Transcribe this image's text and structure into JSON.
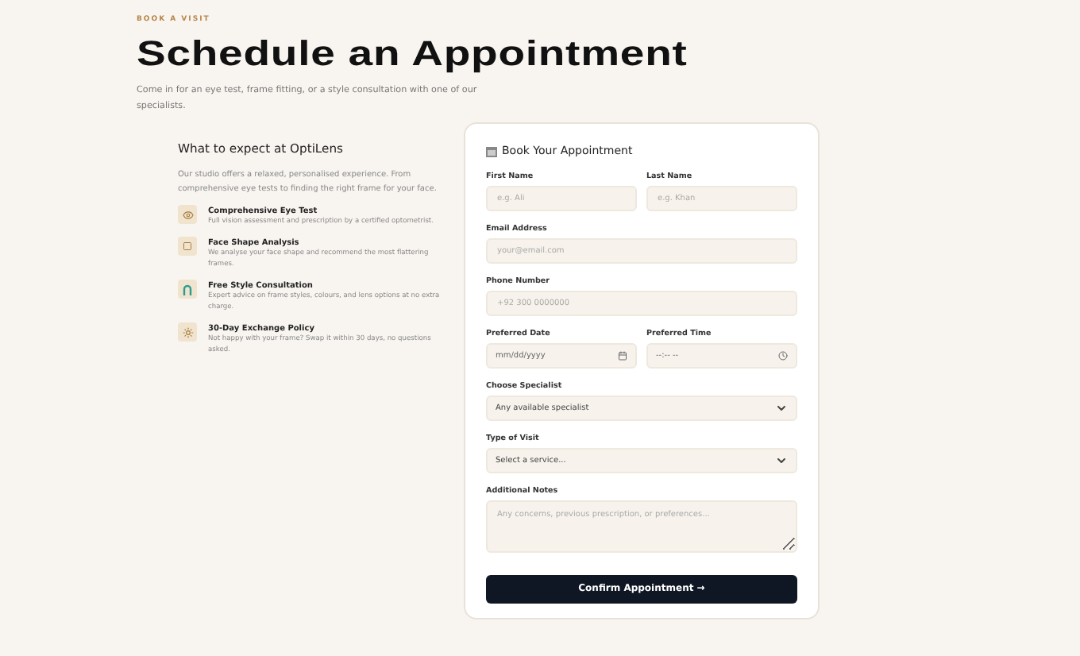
{
  "eyebrow": "BOOK A VISIT",
  "title": "Schedule an Appointment",
  "intro": "Come in for an eye test, frame fitting, or a style consultation with one of our specialists.",
  "info": {
    "heading": "What to expect at OptiLens",
    "text": "Our studio offers a relaxed, personalised experience. From comprehensive eye tests to finding the right frame for your face.",
    "features": [
      {
        "title": "Comprehensive Eye Test",
        "text": "Full vision assessment and prescription by a certified optometrist."
      },
      {
        "title": "Face Shape Analysis",
        "text": "We analyse your face shape and recommend the most flattering frames."
      },
      {
        "title": "Free Style Consultation",
        "text": "Expert advice on frame styles, colours, and lens options at no extra charge."
      },
      {
        "title": "30-Day Exchange Policy",
        "text": "Not happy with your frame? Swap it within 30 days, no questions asked."
      }
    ]
  },
  "form": {
    "heading": "Book Your Appointment",
    "rows": [
      [
        {
          "kind": "text",
          "label": "First Name",
          "placeholder": "e.g. Ali"
        },
        {
          "kind": "text",
          "label": "Last Name",
          "placeholder": "e.g. Khan"
        }
      ],
      [
        {
          "kind": "text",
          "label": "Email Address",
          "placeholder": "your@email.com"
        }
      ],
      [
        {
          "kind": "text",
          "label": "Phone Number",
          "placeholder": "+92 300 0000000"
        }
      ],
      [
        {
          "kind": "date",
          "label": "Preferred Date",
          "value": "mm/dd/yyyy"
        },
        {
          "kind": "time",
          "label": "Preferred Time",
          "value": "--:-- --"
        }
      ],
      [
        {
          "kind": "select",
          "label": "Choose Specialist",
          "value": "Any available specialist"
        }
      ],
      [
        {
          "kind": "select",
          "label": "Type of Visit",
          "value": "Select a service..."
        }
      ],
      [
        {
          "kind": "textarea",
          "label": "Additional Notes",
          "placeholder": "Any concerns, previous prescription, or preferences..."
        }
      ]
    ],
    "submit": "Confirm Appointment →"
  }
}
